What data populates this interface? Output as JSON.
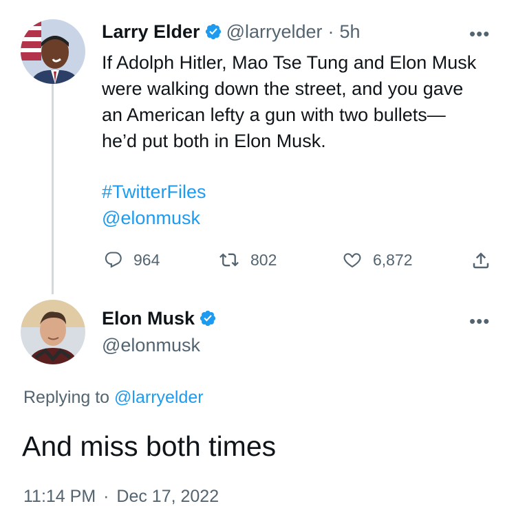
{
  "tweet1": {
    "display_name": "Larry Elder",
    "handle": "@larryelder",
    "separator": "·",
    "time": "5h",
    "more": "•••",
    "text": "If Adolph Hitler, Mao Tse Tung and Elon Musk\nwere walking down the street, and you gave\nan American lefty a gun with two bullets—\nhe’d put both in Elon Musk.",
    "hashtag": "#TwitterFiles",
    "mention": "@elonmusk",
    "actions": {
      "replies": "964",
      "retweets": "802",
      "likes": "6,872"
    }
  },
  "tweet2": {
    "display_name": "Elon Musk",
    "handle": "@elonmusk",
    "more": "•••",
    "replying_label": "Replying to",
    "replying_to": "@larryelder",
    "text": "And miss both times",
    "time": "11:14 PM",
    "separator": "·",
    "date": "Dec 17, 2022"
  },
  "colors": {
    "accent": "#1d9bf0",
    "text": "#0f1419",
    "secondary": "#536471",
    "thread_line": "#cfd9de"
  },
  "icons": [
    "verified-badge-icon",
    "more-icon",
    "reply-icon",
    "retweet-icon",
    "like-icon",
    "share-icon"
  ]
}
